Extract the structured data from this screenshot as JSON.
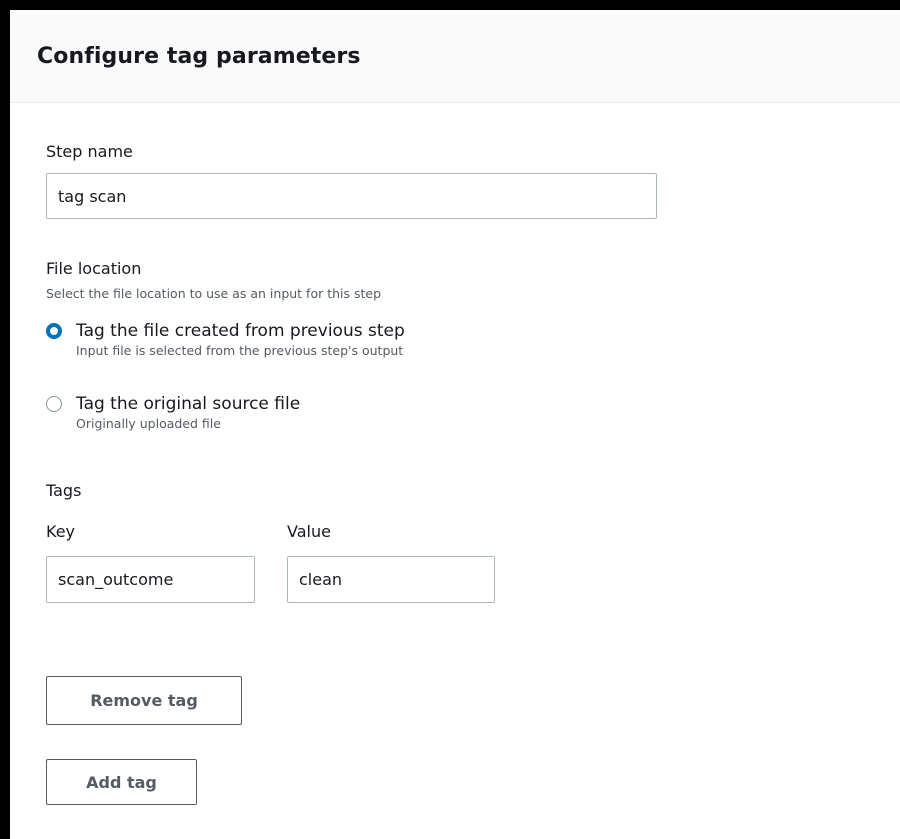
{
  "panel": {
    "title": "Configure tag parameters"
  },
  "step_name": {
    "label": "Step name",
    "value": "tag scan"
  },
  "file_location": {
    "label": "File location",
    "description": "Select the file location to use as an input for this step",
    "options": [
      {
        "label": "Tag the file created from previous step",
        "description": "Input file is selected from the previous step's output",
        "selected": true
      },
      {
        "label": "Tag the original source file",
        "description": "Originally uploaded file",
        "selected": false
      }
    ]
  },
  "tags": {
    "label": "Tags",
    "key_label": "Key",
    "value_label": "Value",
    "items": [
      {
        "key": "scan_outcome",
        "value": "clean"
      }
    ],
    "remove_label": "Remove tag",
    "add_label": "Add tag"
  },
  "colors": {
    "accent": "#0073bb",
    "text": "#16191f",
    "secondary_text": "#545b64",
    "border": "#aab7b8"
  }
}
